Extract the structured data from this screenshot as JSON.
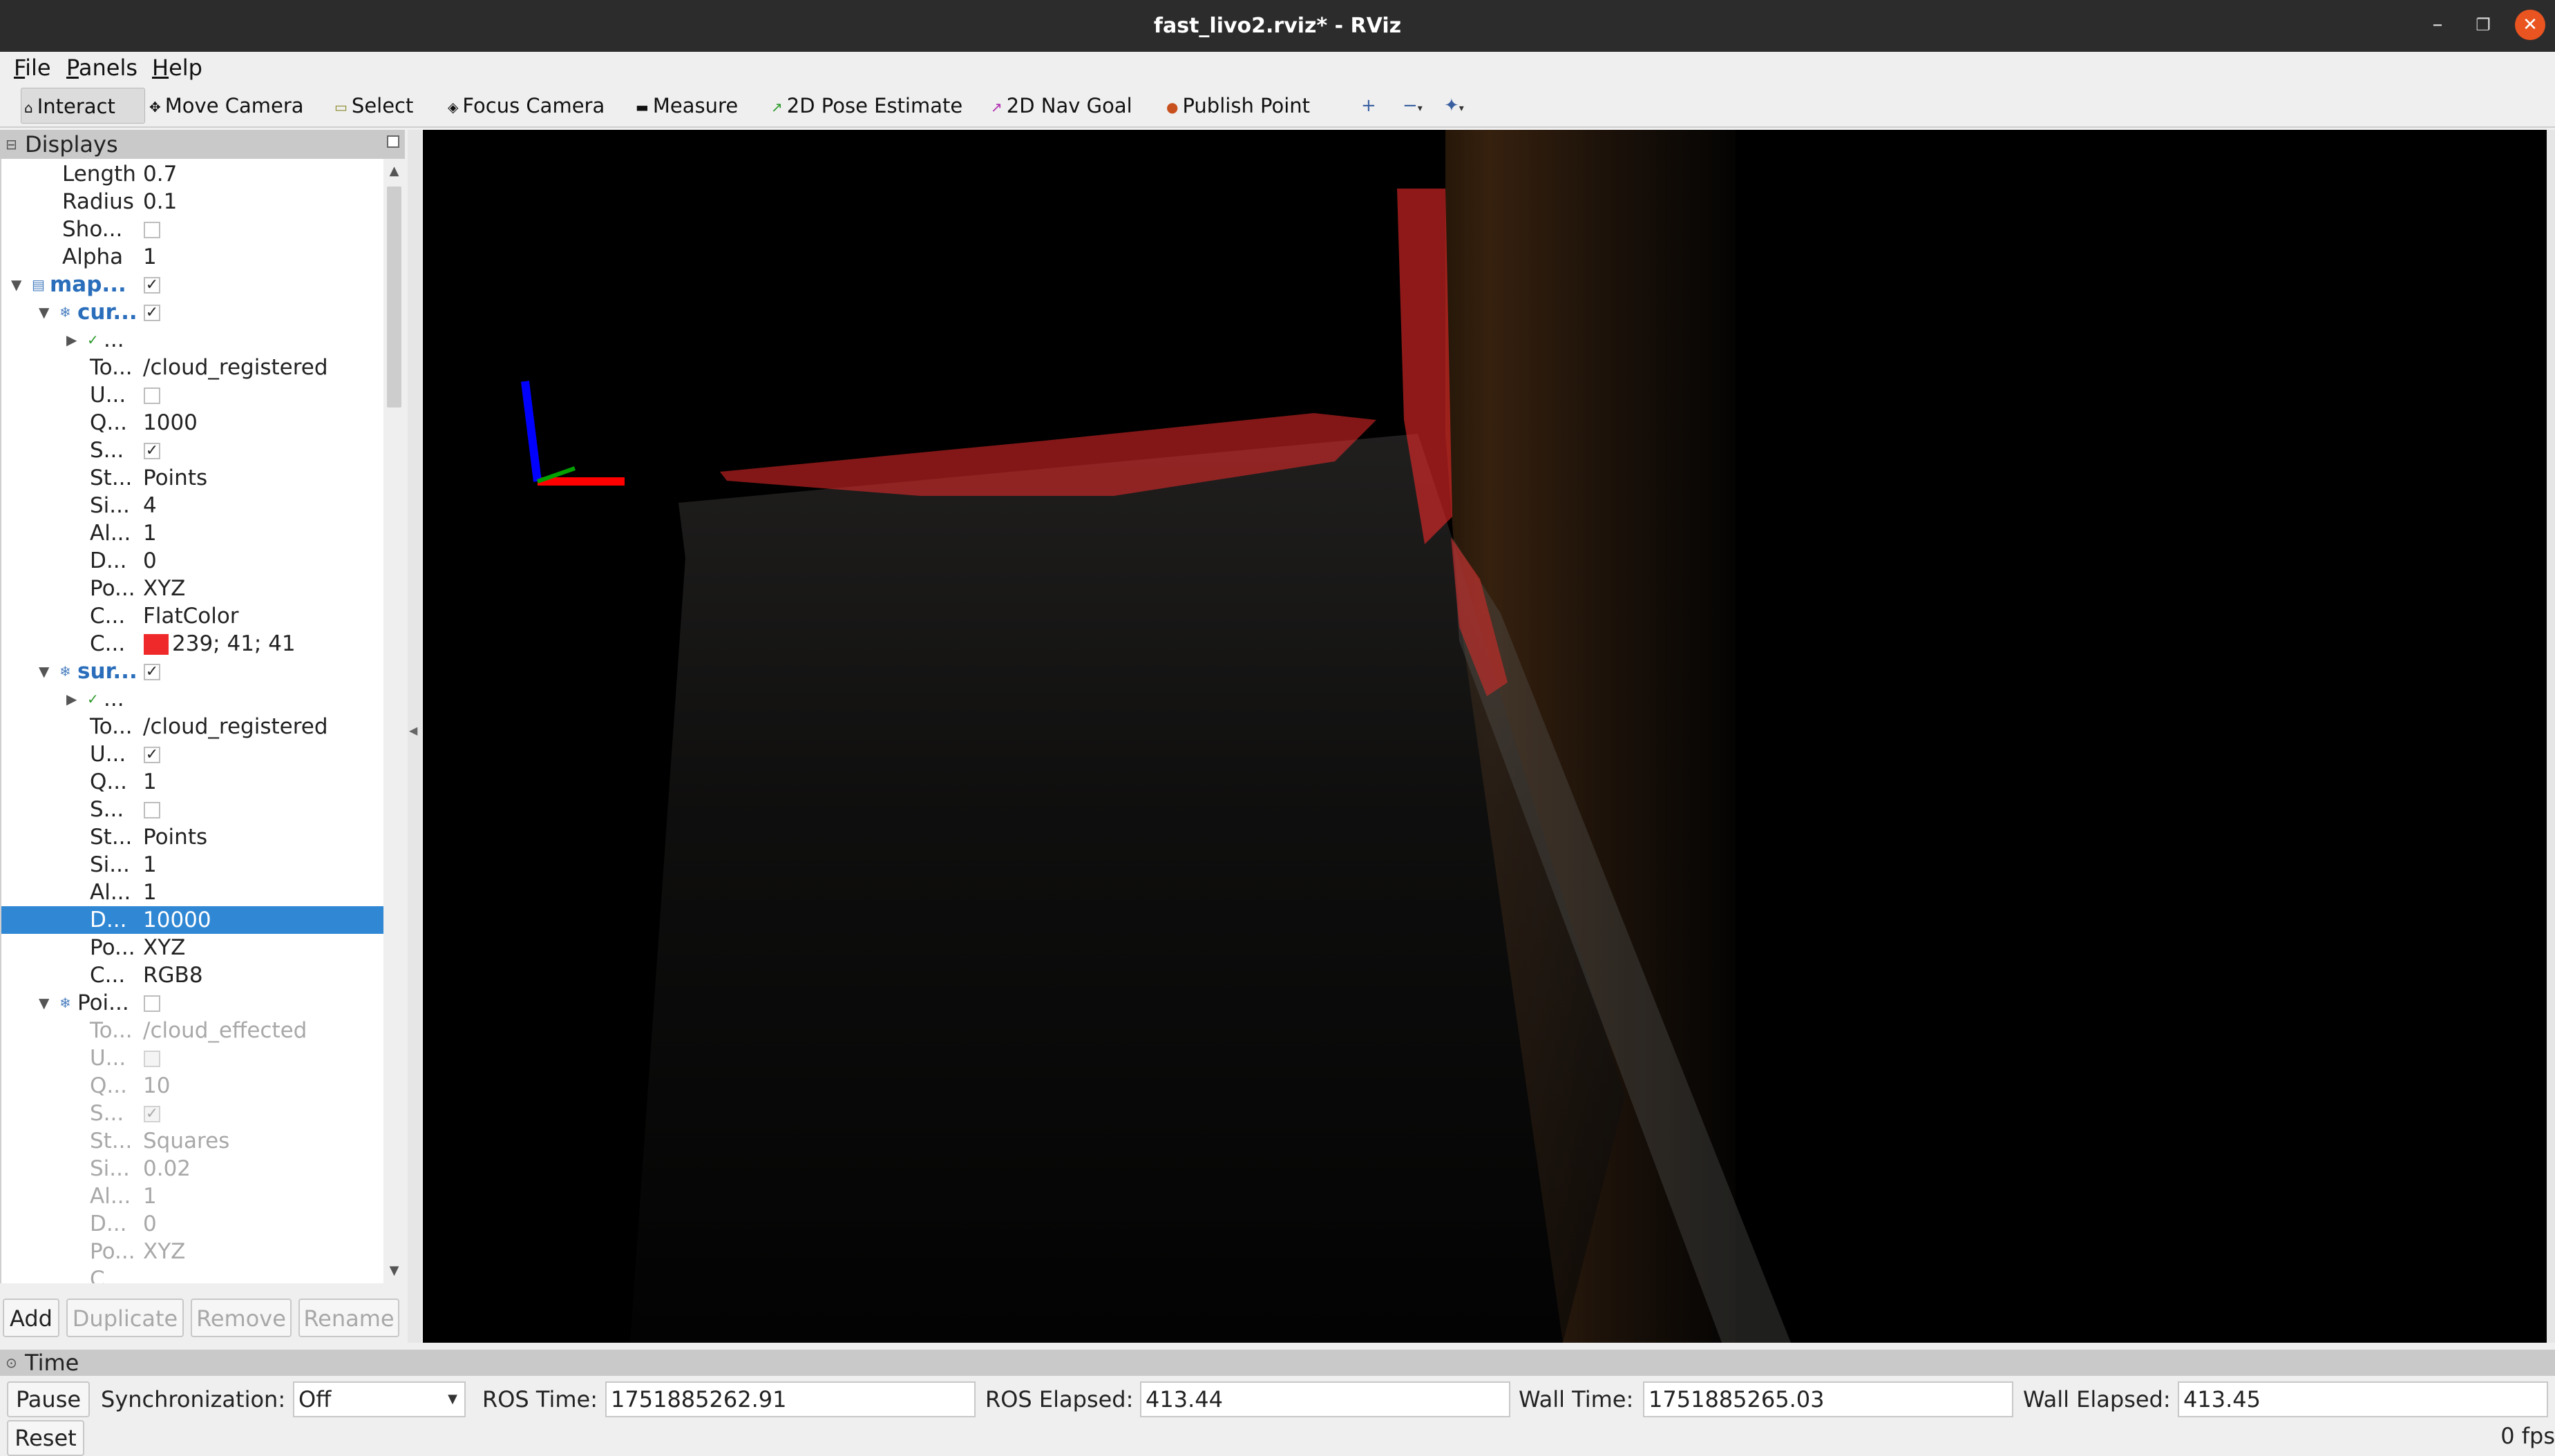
{
  "window": {
    "title": "fast_livo2.rviz* - RViz",
    "min_icon": "minimize-icon",
    "max_icon": "maximize-icon",
    "close_icon": "close-icon"
  },
  "menu": [
    "File",
    "Panels",
    "Help"
  ],
  "toolbar": {
    "tools": [
      "Interact",
      "Move Camera",
      "Select",
      "Focus Camera",
      "Measure",
      "2D Pose Estimate",
      "2D Nav Goal",
      "Publish Point"
    ],
    "extra_icons": [
      "plus-icon",
      "minus-icon",
      "crosshair-icon"
    ]
  },
  "displays": {
    "title": "Displays",
    "rows": [
      {
        "name": "Length",
        "value": "0.7"
      },
      {
        "name": "Radius",
        "value": "0.1"
      },
      {
        "name": "Sho...",
        "checked": false
      },
      {
        "name": "Alpha",
        "value": "1"
      },
      {
        "name": "map...",
        "checked": true
      },
      {
        "name": "cur...",
        "checked": true
      },
      {
        "name": "..."
      },
      {
        "name": "To...",
        "value": "/cloud_registered"
      },
      {
        "name": "U...",
        "checked": false
      },
      {
        "name": "Q...",
        "value": "1000"
      },
      {
        "name": "S...",
        "checked": true
      },
      {
        "name": "St...",
        "value": "Points"
      },
      {
        "name": "Si...",
        "value": "4"
      },
      {
        "name": "Al...",
        "value": "1"
      },
      {
        "name": "D...",
        "value": "0"
      },
      {
        "name": "Po...",
        "value": "XYZ"
      },
      {
        "name": "C...",
        "value": "FlatColor"
      },
      {
        "name": "C...",
        "value": "239; 41; 41",
        "swatch": "#ef2929"
      },
      {
        "name": "sur...",
        "checked": true
      },
      {
        "name": "..."
      },
      {
        "name": "To...",
        "value": "/cloud_registered"
      },
      {
        "name": "U...",
        "checked": true
      },
      {
        "name": "Q...",
        "value": "1"
      },
      {
        "name": "S...",
        "checked": false
      },
      {
        "name": "St...",
        "value": "Points"
      },
      {
        "name": "Si...",
        "value": "1"
      },
      {
        "name": "Al...",
        "value": "1"
      },
      {
        "name": "D...",
        "value": "10000"
      },
      {
        "name": "Po...",
        "value": "XYZ"
      },
      {
        "name": "C...",
        "value": "RGB8"
      },
      {
        "name": "Poi...",
        "checked": false
      },
      {
        "name": "To...",
        "value": "/cloud_effected"
      },
      {
        "name": "U...",
        "checked": false
      },
      {
        "name": "Q...",
        "value": "10"
      },
      {
        "name": "S...",
        "checked": true
      },
      {
        "name": "St...",
        "value": "Squares"
      },
      {
        "name": "Si...",
        "value": "0.02"
      },
      {
        "name": "Al...",
        "value": "1"
      },
      {
        "name": "D...",
        "value": "0"
      },
      {
        "name": "Po...",
        "value": "XYZ"
      },
      {
        "name": "C..."
      }
    ],
    "buttons": {
      "add": "Add",
      "duplicate": "Duplicate",
      "remove": "Remove",
      "rename": "Rename"
    }
  },
  "time": {
    "title": "Time",
    "pause": "Pause",
    "sync_label": "Synchronization:",
    "sync_value": "Off",
    "ros_time_label": "ROS Time:",
    "ros_time": "1751885262.91",
    "ros_elapsed_label": "ROS Elapsed:",
    "ros_elapsed": "413.44",
    "wall_time_label": "Wall Time:",
    "wall_time": "1751885265.03",
    "wall_elapsed_label": "Wall Elapsed:",
    "wall_elapsed": "413.45",
    "reset": "Reset",
    "fps": "0 fps"
  },
  "colors": {
    "accent_selection": "#3087d4",
    "flat_color": "#ef2929",
    "viewport_bg": "#000000"
  }
}
